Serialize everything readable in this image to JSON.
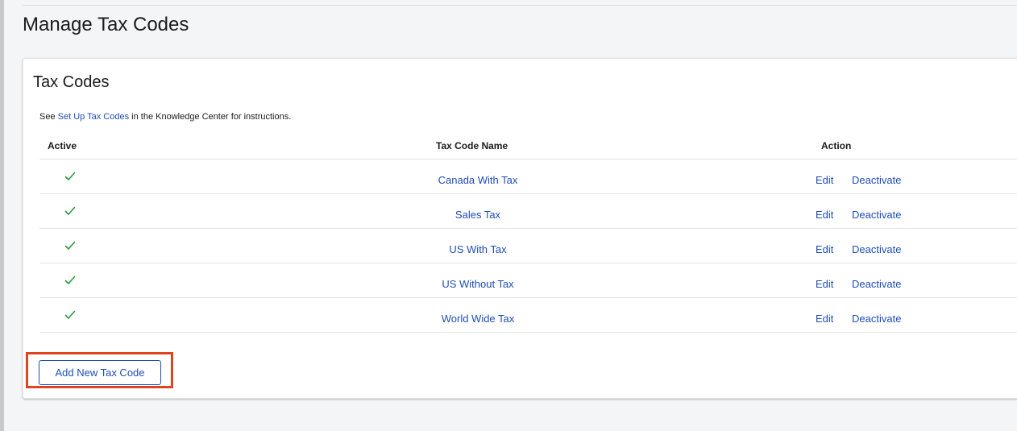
{
  "page": {
    "title": "Manage Tax Codes"
  },
  "panel": {
    "title": "Tax Codes",
    "instructions": {
      "prefix": "See ",
      "link_text": "Set Up Tax Codes",
      "suffix": " in the Knowledge Center for instructions."
    }
  },
  "table": {
    "headers": {
      "active": "Active",
      "name": "Tax Code Name",
      "action": "Action"
    },
    "rows": [
      {
        "active": true,
        "name": "Canada With Tax",
        "edit": "Edit",
        "deactivate": "Deactivate"
      },
      {
        "active": true,
        "name": "Sales Tax",
        "edit": "Edit",
        "deactivate": "Deactivate"
      },
      {
        "active": true,
        "name": "US With Tax",
        "edit": "Edit",
        "deactivate": "Deactivate"
      },
      {
        "active": true,
        "name": "US Without Tax",
        "edit": "Edit",
        "deactivate": "Deactivate"
      },
      {
        "active": true,
        "name": "World Wide Tax",
        "edit": "Edit",
        "deactivate": "Deactivate"
      }
    ]
  },
  "actions": {
    "add_label": "Add New Tax Code"
  },
  "colors": {
    "link": "#1f4db5",
    "check": "#2a9a3c",
    "highlight": "#e1431f"
  },
  "icons": {
    "active": "checkmark-icon"
  }
}
